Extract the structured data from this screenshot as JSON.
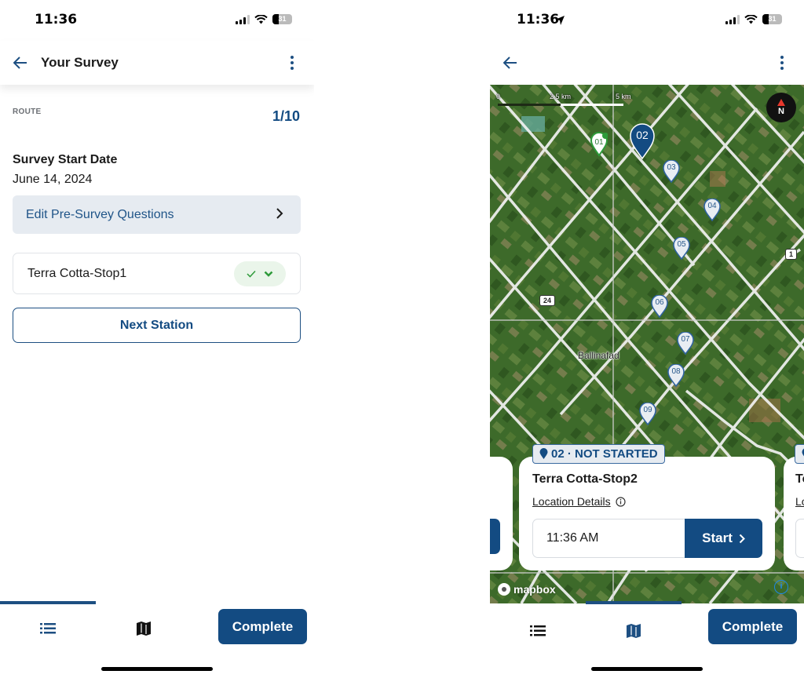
{
  "left_screen": {
    "status_bar": {
      "time": "11:36",
      "battery": "31"
    },
    "appbar": {
      "title": "Your Survey"
    },
    "route": {
      "label": "ROUTE",
      "count": "1/10"
    },
    "survey_start": {
      "title": "Survey Start Date",
      "date": "June 14, 2024"
    },
    "pre_survey_button": "Edit Pre-Survey Questions",
    "stop": {
      "name": "Terra Cotta-Stop1",
      "status": "completed"
    },
    "next_station_button": "Next Station",
    "bottom_nav": {
      "active_tab": "list",
      "complete_label": "Complete"
    }
  },
  "right_screen": {
    "status_bar": {
      "time": "11:36",
      "battery": "31"
    },
    "map": {
      "scale": [
        "0",
        "2.5 km",
        "5 km"
      ],
      "compass_label": "N",
      "place_label": "Ballinafad",
      "road_shields": [
        "24",
        "1"
      ],
      "attribution": "mapbox",
      "pins": [
        {
          "label": "01",
          "state": "completed"
        },
        {
          "label": "02",
          "state": "selected"
        },
        {
          "label": "03",
          "state": "default"
        },
        {
          "label": "04",
          "state": "default"
        },
        {
          "label": "05",
          "state": "default"
        },
        {
          "label": "06",
          "state": "default"
        },
        {
          "label": "07",
          "state": "default"
        },
        {
          "label": "08",
          "state": "default"
        },
        {
          "label": "09",
          "state": "default"
        }
      ]
    },
    "station_card": {
      "status_pill": "02 · NOT STARTED",
      "title": "Terra Cotta-Stop2",
      "location_link": "Location Details",
      "time_value": "11:36 AM",
      "start_label": "Start"
    },
    "next_card_peek": {
      "title": "Te",
      "link": "Lo"
    },
    "bottom_nav": {
      "active_tab": "map",
      "complete_label": "Complete"
    }
  },
  "colors": {
    "primary": "#134b82",
    "pill_bg": "#e6ebf1",
    "success": "#2e9b3a"
  }
}
